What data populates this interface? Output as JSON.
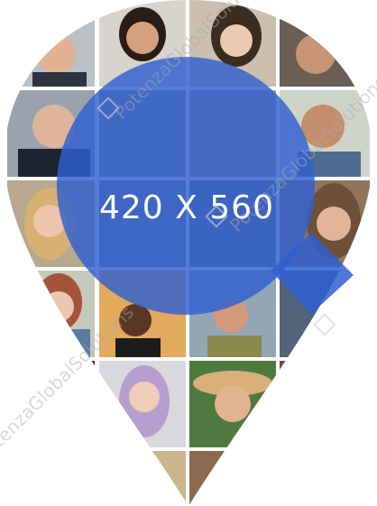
{
  "placeholder": {
    "label": "420 X 560",
    "watermark_text": "PotenzaGlobalSolutions",
    "colors": {
      "pin_background": "#ffffff",
      "magnifier_blue": "#2f5fd0",
      "cell_divider": "#ffffff"
    },
    "icons": [
      "map-pin-icon",
      "magnifier-icon",
      "watermark-logo-icon"
    ]
  }
}
